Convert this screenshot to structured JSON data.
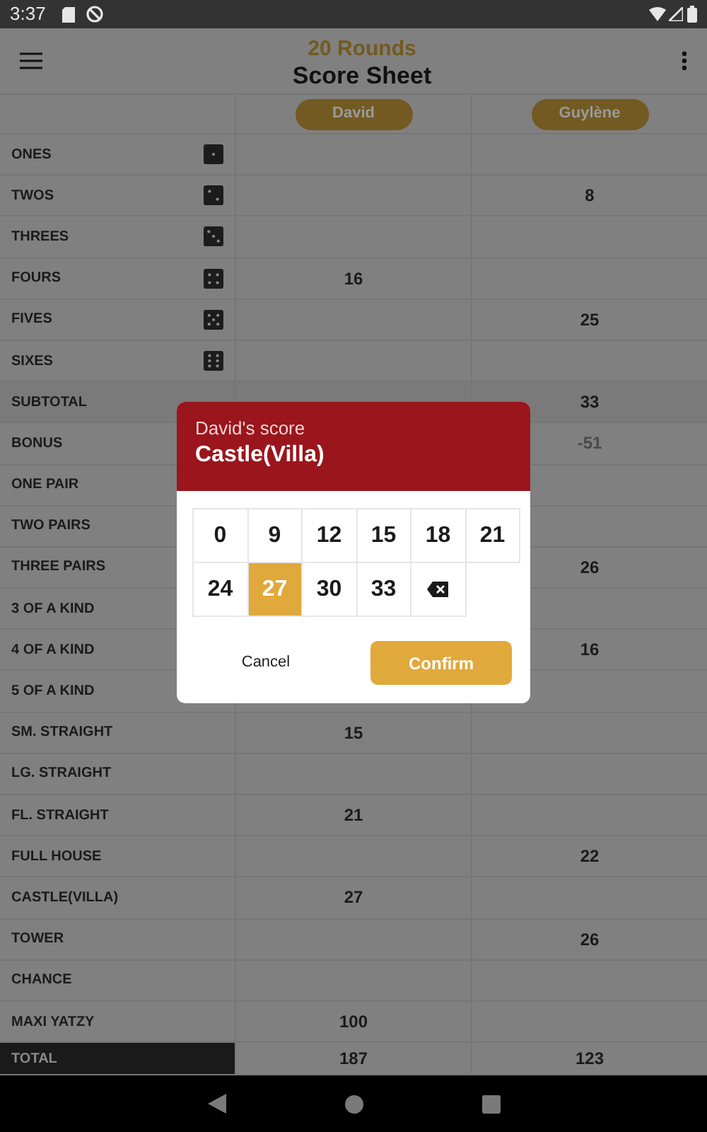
{
  "status_bar": {
    "time": "3:37"
  },
  "app_bar": {
    "subtitle": "20 Rounds",
    "title": "Score Sheet"
  },
  "players": [
    {
      "name": "David"
    },
    {
      "name": "Guylène"
    }
  ],
  "rows": [
    {
      "label": "ONES",
      "kind": "die"
    },
    {
      "label": "TWOS",
      "kind": "die",
      "column_2": "8"
    },
    {
      "label": "THREES",
      "kind": "die"
    },
    {
      "label": "FOURS",
      "kind": "die",
      "column_1": "16"
    },
    {
      "label": "FIVES",
      "kind": "die",
      "column_2": "25"
    },
    {
      "label": "SIXES",
      "kind": "die"
    },
    {
      "label": "SUBTOTAL",
      "kind": "subtotal",
      "column_2": "33"
    },
    {
      "label": "BONUS",
      "kind": "bonus",
      "column_2": "-51"
    },
    {
      "label": "ONE PAIR",
      "kind": "plain"
    },
    {
      "label": "TWO PAIRS",
      "kind": "plain"
    },
    {
      "label": "THREE PAIRS",
      "kind": "plain",
      "column_2": "26"
    },
    {
      "label": "3 OF A KIND",
      "kind": "plain"
    },
    {
      "label": "4 OF A KIND",
      "kind": "plain",
      "column_2": "16"
    },
    {
      "label": "5 OF A KIND",
      "kind": "plain"
    },
    {
      "label": "SM. STRAIGHT",
      "kind": "plain",
      "column_1": "15"
    },
    {
      "label": "LG. STRAIGHT",
      "kind": "plain"
    },
    {
      "label": "FL. STRAIGHT",
      "kind": "plain",
      "column_1": "21"
    },
    {
      "label": "FULL HOUSE",
      "kind": "plain",
      "column_2": "22"
    },
    {
      "label": "CASTLE(VILLA)",
      "kind": "plain",
      "column_1": "27"
    },
    {
      "label": "TOWER",
      "kind": "plain",
      "column_2": "26"
    },
    {
      "label": "CHANCE",
      "kind": "plain"
    },
    {
      "label": "MAXI YATZY",
      "kind": "plain",
      "column_1": "100"
    },
    {
      "label": "TOTAL",
      "kind": "total",
      "column_1": "187",
      "column_2": "123"
    }
  ],
  "dialog": {
    "subtitle": "David's score",
    "title": "Castle(Villa)",
    "keys": [
      {
        "kind": "number",
        "label": "0",
        "selected": false
      },
      {
        "kind": "number",
        "label": "9",
        "selected": false
      },
      {
        "kind": "number",
        "label": "12",
        "selected": false
      },
      {
        "kind": "number",
        "label": "15",
        "selected": false
      },
      {
        "kind": "number",
        "label": "18",
        "selected": false
      },
      {
        "kind": "number",
        "label": "21",
        "selected": false
      },
      {
        "kind": "number",
        "label": "24",
        "selected": false
      },
      {
        "kind": "number",
        "label": "27",
        "selected": true
      },
      {
        "kind": "number",
        "label": "30",
        "selected": false
      },
      {
        "kind": "number",
        "label": "33",
        "selected": false
      },
      {
        "kind": "backspace",
        "selected": false
      }
    ],
    "cancel": "Cancel",
    "confirm": "Confirm"
  }
}
